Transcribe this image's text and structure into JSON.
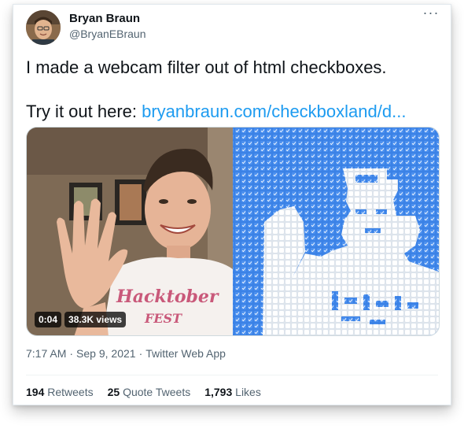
{
  "author": {
    "name": "Bryan Braun",
    "handle": "@BryanEBraun"
  },
  "tweet": {
    "line1": "I made a webcam filter out of html checkboxes.",
    "line2_prefix": "Try it out here: ",
    "link_text": "bryanbraun.com/checkboxland/d..."
  },
  "media": {
    "video_time": "0:04",
    "video_views": "38.3K views",
    "shirt_text": "Hacktober FEST"
  },
  "meta": {
    "time": "7:17 AM",
    "sep": "·",
    "date": "Sep 9, 2021",
    "source": "Twitter Web App"
  },
  "stats": {
    "retweets_count": "194",
    "retweets_label": "Retweets",
    "quotes_count": "25",
    "quotes_label": "Quote Tweets",
    "likes_count": "1,793",
    "likes_label": "Likes"
  },
  "icons": {
    "more": "more-horizontal-icon"
  },
  "colors": {
    "link": "#1d9bf0",
    "checkbox_blue": "#3b82e6",
    "secondary_text": "#536471"
  }
}
